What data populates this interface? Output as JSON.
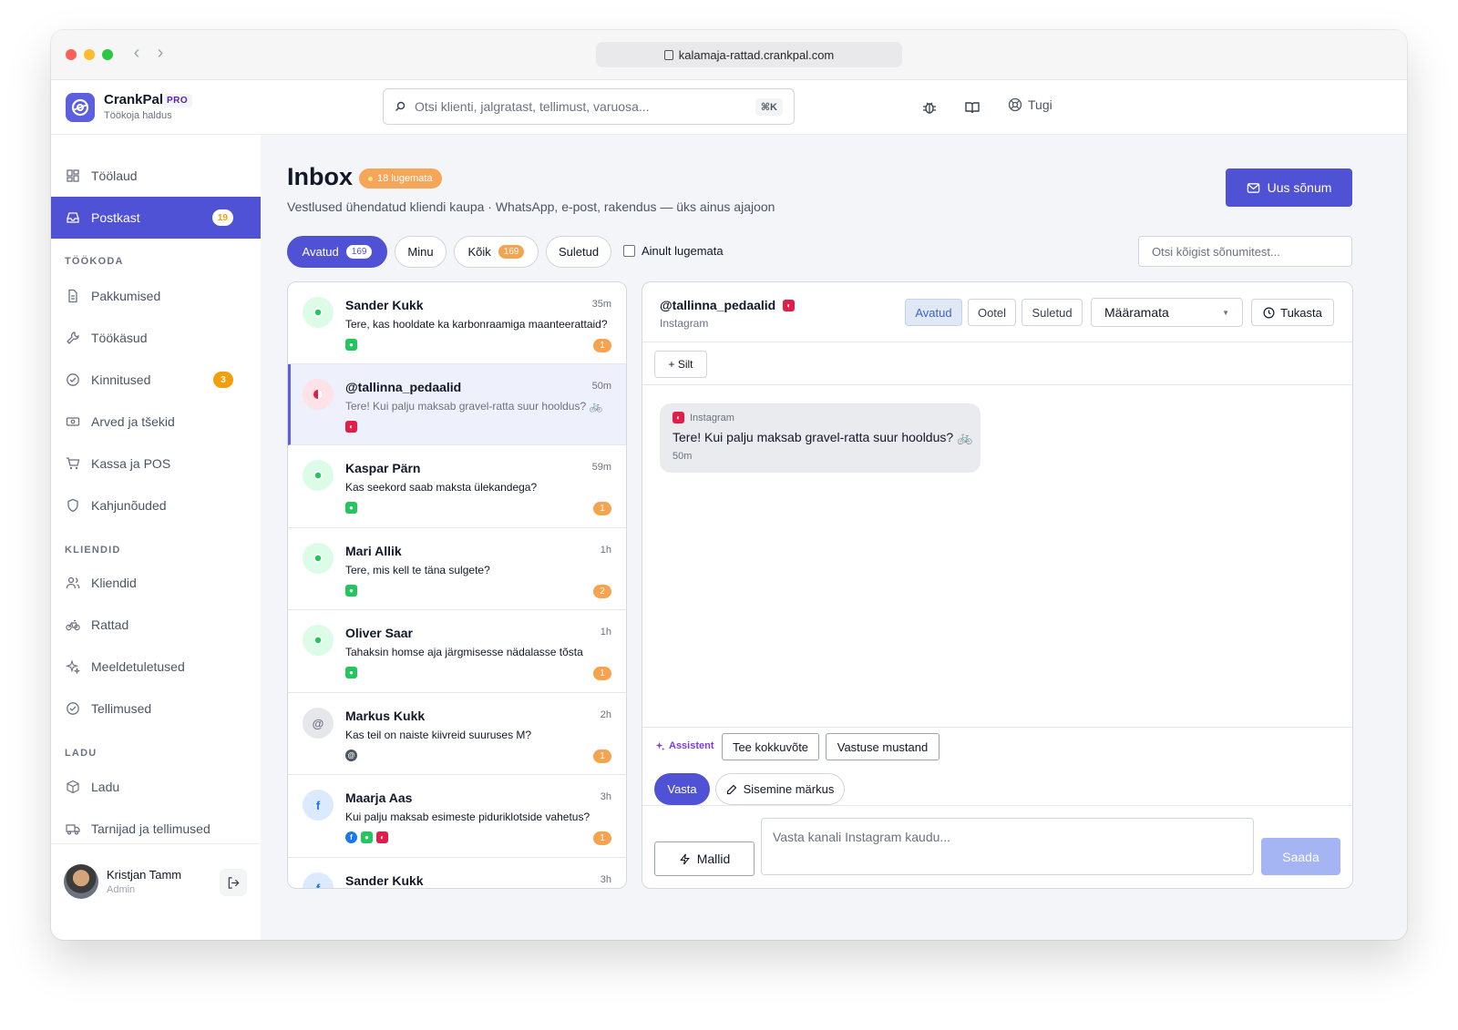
{
  "browser": {
    "url": "kalamaja-rattad.crankpal.com"
  },
  "app": {
    "name": "CrankPal",
    "tier": "PRO",
    "subtitle": "Töökoja haldus"
  },
  "search": {
    "placeholder": "Otsi klienti, jalgratast, tellimust, varuosa...",
    "shortcut": "⌘K"
  },
  "topnav": {
    "support_label": "Tugi"
  },
  "sidebar": {
    "main_items": [
      {
        "label": "Töölaud",
        "icon": "dashboard-icon"
      },
      {
        "label": "Postkast",
        "icon": "inbox-icon",
        "badge": "19",
        "active": true
      }
    ],
    "section_workshop": "TÖÖKODA",
    "workshop_items": [
      {
        "label": "Pakkumised",
        "icon": "document-icon"
      },
      {
        "label": "Töökäsud",
        "icon": "wrench-icon"
      },
      {
        "label": "Kinnitused",
        "icon": "check-circle-icon",
        "badge": "3"
      },
      {
        "label": "Arved ja tšekid",
        "icon": "banknote-icon"
      },
      {
        "label": "Kassa ja POS",
        "icon": "cart-icon"
      },
      {
        "label": "Kahjunõuded",
        "icon": "shield-icon"
      }
    ],
    "section_clients": "KLIENDID",
    "client_items": [
      {
        "label": "Kliendid",
        "icon": "users-icon"
      },
      {
        "label": "Rattad",
        "icon": "bike-icon"
      },
      {
        "label": "Meeldetuletused",
        "icon": "sparkle-icon"
      },
      {
        "label": "Tellimused",
        "icon": "check-circle-icon"
      }
    ],
    "section_stock": "LADU",
    "stock_items": [
      {
        "label": "Ladu",
        "icon": "box-icon"
      },
      {
        "label": "Tarnijad ja tellimused",
        "icon": "truck-icon"
      }
    ],
    "user": {
      "name": "Kristjan Tamm",
      "role": "Admin"
    }
  },
  "inbox": {
    "title": "Inbox",
    "unread_badge": "18 lugemata",
    "subtitle": "Vestlused ühendatud kliendi kaupa · WhatsApp, e-post, rakendus — üks ainus ajajoon",
    "new_message_label": "Uus sõnum",
    "filters": [
      {
        "label": "Avatud",
        "count": "169",
        "active": true
      },
      {
        "label": "Minu"
      },
      {
        "label": "Kõik",
        "count": "169"
      },
      {
        "label": "Suletud"
      }
    ],
    "only_unread_label": "Ainult lugemata",
    "search_all_placeholder": "Otsi kõigist sõnumitest..."
  },
  "conversations": [
    {
      "name": "Sander Kukk",
      "time": "35m",
      "preview": "Tere, kas hooldate ka karbonraamiga maanteerattaid?",
      "channels": [
        "whatsapp"
      ],
      "unread": "1",
      "avatar": "whatsapp"
    },
    {
      "name": "@tallinna_pedaalid",
      "time": "50m",
      "preview": "Tere! Kui palju maksab gravel-ratta suur hooldus? 🚲",
      "channels": [
        "instagram"
      ],
      "avatar": "instagram",
      "selected": true
    },
    {
      "name": "Kaspar Pärn",
      "time": "59m",
      "preview": "Kas seekord saab maksta ülekandega?",
      "channels": [
        "whatsapp"
      ],
      "unread": "1",
      "avatar": "whatsapp"
    },
    {
      "name": "Mari Allik",
      "time": "1h",
      "preview": "Tere, mis kell te täna sulgete?",
      "channels": [
        "whatsapp"
      ],
      "unread": "2",
      "avatar": "whatsapp"
    },
    {
      "name": "Oliver Saar",
      "time": "1h",
      "preview": "Tahaksin homse aja järgmisesse nädalasse tõsta",
      "channels": [
        "whatsapp"
      ],
      "unread": "1",
      "avatar": "whatsapp"
    },
    {
      "name": "Markus Kukk",
      "time": "2h",
      "preview": "Kas teil on naiste kiivreid suuruses M?",
      "channels": [
        "email"
      ],
      "unread": "1",
      "avatar": "email"
    },
    {
      "name": "Maarja Aas",
      "time": "3h",
      "preview": "Kui palju maksab esimeste piduriklotside vahetus?",
      "channels": [
        "facebook",
        "whatsapp",
        "instagram"
      ],
      "unread": "1",
      "avatar": "facebook"
    },
    {
      "name": "Sander Kukk",
      "time": "3h",
      "preview": "",
      "channels": [],
      "avatar": "facebook"
    }
  ],
  "detail": {
    "contact_name": "@tallinna_pedaalid",
    "channel": "Instagram",
    "status_buttons": [
      "Avatud",
      "Ootel",
      "Suletud"
    ],
    "active_status": "Avatud",
    "assignee": "Määramata",
    "snooze_label": "Tukasta",
    "tag_label": "+ Silt",
    "message": {
      "channel": "Instagram",
      "text": "Tere! Kui palju maksab gravel-ratta suur hooldus? 🚲",
      "time": "50m"
    },
    "assistant_label": "Assistent",
    "assistant_actions": [
      "Tee kokkuvõte",
      "Vastuse mustand"
    ],
    "compose_tabs": [
      "Vasta",
      "Sisemine märkus"
    ],
    "templates_label": "Mallid",
    "reply_placeholder": "Vasta kanali Instagram kaudu...",
    "send_label": "Saada"
  },
  "colors": {
    "accent": "#4f52d4",
    "badge_orange": "#f5a34f",
    "whatsapp": "#22c55e",
    "instagram": "#e11d48",
    "facebook": "#1877f2"
  }
}
